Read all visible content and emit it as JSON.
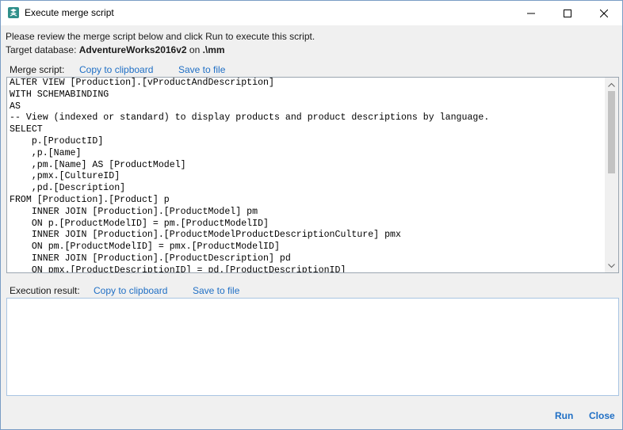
{
  "window": {
    "title": "Execute merge script",
    "min_label": "",
    "max_label": "",
    "close_label": ""
  },
  "info": {
    "instruction": "Please review the merge script below and click Run to execute this script.",
    "target_prefix": "Target database: ",
    "target_db": "AdventureWorks2016v2",
    "target_on": " on ",
    "target_server": ".\\mm"
  },
  "merge_script": {
    "label": "Merge script:",
    "copy_label": "Copy to clipboard",
    "save_label": "Save to file",
    "code": "ALTER VIEW [Production].[vProductAndDescription]\nWITH SCHEMABINDING\nAS\n-- View (indexed or standard) to display products and product descriptions by language.\nSELECT\n    p.[ProductID]\n    ,p.[Name]\n    ,pm.[Name] AS [ProductModel]\n    ,pmx.[CultureID]\n    ,pd.[Description]\nFROM [Production].[Product] p\n    INNER JOIN [Production].[ProductModel] pm\n    ON p.[ProductModelID] = pm.[ProductModelID]\n    INNER JOIN [Production].[ProductModelProductDescriptionCulture] pmx\n    ON pm.[ProductModelID] = pmx.[ProductModelID]\n    INNER JOIN [Production].[ProductDescription] pd\n    ON pmx.[ProductDescriptionID] = pd.[ProductDescriptionID]"
  },
  "execution_result": {
    "label": "Execution result:",
    "copy_label": "Copy to clipboard",
    "save_label": "Save to file",
    "value": ""
  },
  "actions": {
    "run_label": "Run",
    "close_label": "Close"
  },
  "colors": {
    "link": "#1f6fc5",
    "title_bg": "#ffffff",
    "body_bg": "#f0f0f0"
  }
}
